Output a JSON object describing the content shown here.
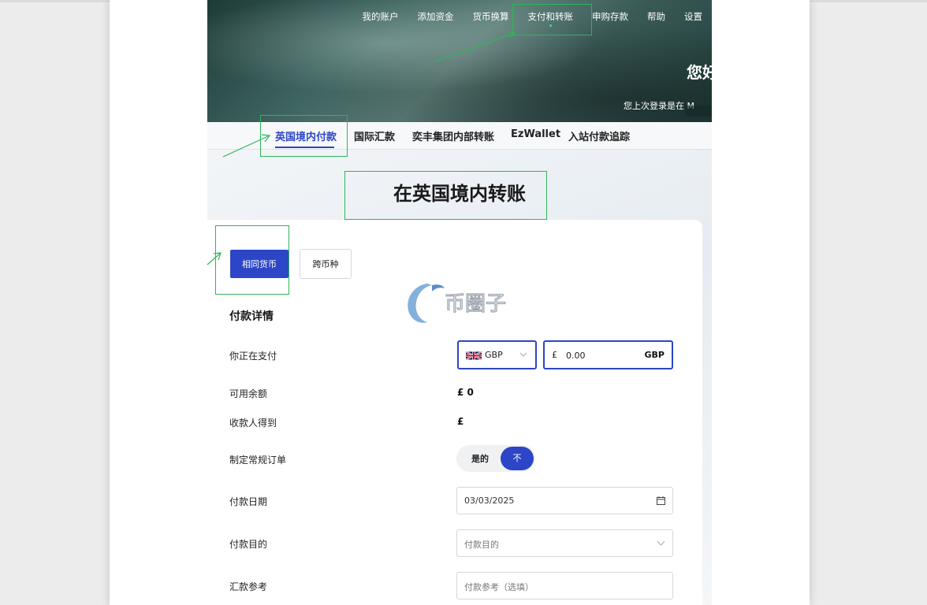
{
  "nav": {
    "items": [
      {
        "label": "我的账户"
      },
      {
        "label": "添加资金"
      },
      {
        "label": "货币换算"
      },
      {
        "label": "支付和转账"
      },
      {
        "label": "申购存款"
      },
      {
        "label": "帮助"
      },
      {
        "label": "设置"
      }
    ],
    "active_index": 3
  },
  "hero": {
    "greeting": "您好",
    "last_login": "您上次登录是在 M"
  },
  "subnav": {
    "items": [
      {
        "label": "英国境内付款"
      },
      {
        "label": "国际汇款"
      },
      {
        "label": "奕丰集团内部转账"
      },
      {
        "label": "EzWallet"
      },
      {
        "label": "入站付款追踪"
      }
    ],
    "active_index": 0
  },
  "page_title": "在英国境内转账",
  "currency_type": {
    "same_label": "相同货币",
    "cross_label": "跨币种",
    "selected": "same"
  },
  "payment_details": {
    "section_title": "付款详情",
    "you_pay_label": "你正在支付",
    "currency_code": "GBP",
    "amount_symbol": "£",
    "amount_value": "0.00",
    "amount_currency": "GBP",
    "available_label": "可用余额",
    "available_value": "£ 0",
    "recipient_label": "收款人得到",
    "recipient_value": "£",
    "standing_order_label": "制定常规订单",
    "standing_yes": "是的",
    "standing_no": "不",
    "standing_selected": "不",
    "date_label": "付款日期",
    "date_value": "03/03/2025",
    "purpose_label": "付款目的",
    "purpose_placeholder": "付款目的",
    "reference_label": "汇款参考",
    "reference_placeholder": "付款参考（选填）"
  },
  "watermark": {
    "text": "币圈子"
  },
  "colors": {
    "accent": "#2c46c7",
    "annotation": "#2fb55a",
    "hero_dark": "#22403d",
    "indicator": "#2ee0a8"
  }
}
